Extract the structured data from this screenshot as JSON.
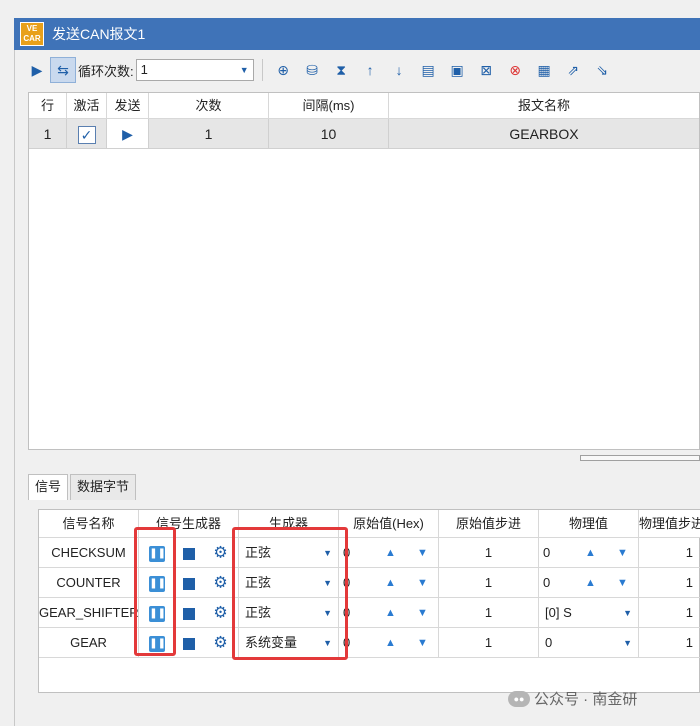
{
  "window": {
    "title": "发送CAN报文1",
    "logo_text": "VECAR"
  },
  "toolbar": {
    "loop_label": "循环次数:",
    "loop_value": "1",
    "icons": [
      "play-icon",
      "loop-toggle-icon",
      "add-icon",
      "database-add-icon",
      "hourglass-icon",
      "arrow-up-icon",
      "arrow-down-icon",
      "copy-icon",
      "paste-icon",
      "delete-icon",
      "clear-icon",
      "save-icon",
      "export-icon",
      "import-icon"
    ]
  },
  "top_grid": {
    "headers": [
      "行",
      "激活",
      "发送",
      "次数",
      "间隔(ms)",
      "报文名称"
    ],
    "rows": [
      {
        "row": "1",
        "active": true,
        "count": "1",
        "interval": "10",
        "name": "GEARBOX"
      }
    ]
  },
  "tabs": [
    "信号",
    "数据字节"
  ],
  "bottom_grid": {
    "headers": [
      "信号名称",
      "信号生成器",
      "生成器",
      "原始值(Hex)",
      "原始值步进",
      "物理值",
      "物理值步进"
    ],
    "rows": [
      {
        "name": "CHECKSUM",
        "generator": "正弦",
        "raw": "0",
        "step": "1",
        "phys": "0",
        "phys_step": "1"
      },
      {
        "name": "COUNTER",
        "generator": "正弦",
        "raw": "0",
        "step": "1",
        "phys": "0",
        "phys_step": "1"
      },
      {
        "name": "GEAR_SHIFTER",
        "generator": "正弦",
        "raw": "0",
        "step": "1",
        "phys": "[0] S",
        "phys_step": "1"
      },
      {
        "name": "GEAR",
        "generator": "系统变量",
        "raw": "0",
        "step": "1",
        "phys": "0",
        "phys_step": "1"
      }
    ]
  },
  "watermark": "公众号 · 南金研",
  "colors": {
    "accent": "#1f5fa8",
    "title_bar": "#3f73b8",
    "highlight": "#e3393a"
  }
}
